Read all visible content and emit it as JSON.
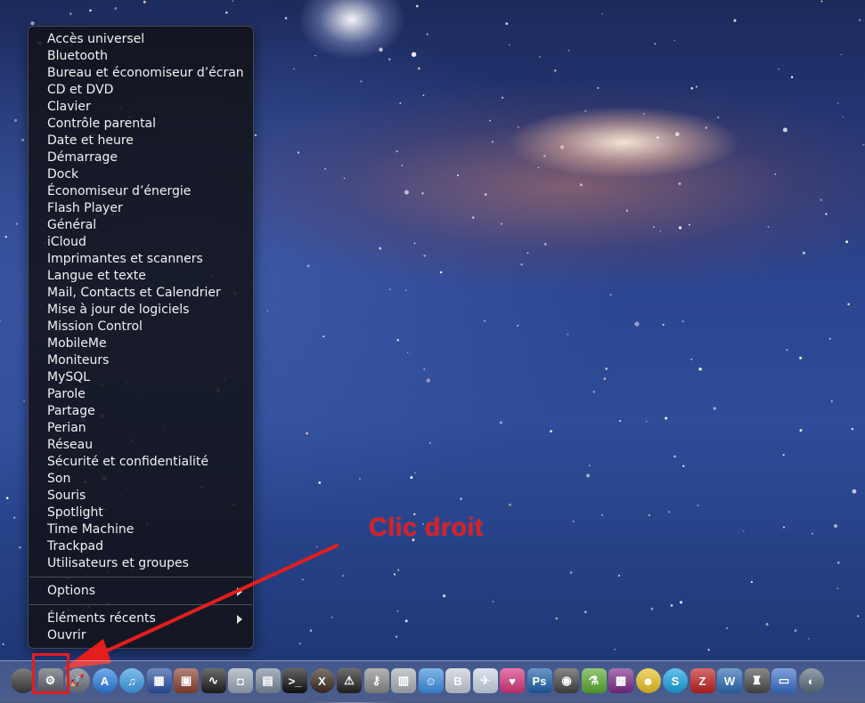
{
  "context_menu": {
    "items": [
      "Accès universel",
      "Bluetooth",
      "Bureau et économiseur d’écran",
      "CD et DVD",
      "Clavier",
      "Contrôle parental",
      "Date et heure",
      "Démarrage",
      "Dock",
      "Économiseur d’énergie",
      "Flash Player",
      "Général",
      "iCloud",
      "Imprimantes et scanners",
      "Langue et texte",
      "Mail, Contacts et Calendrier",
      "Mise à jour de logiciels",
      "Mission Control",
      "MobileMe",
      "Moniteurs",
      "MySQL",
      "Parole",
      "Partage",
      "Perian",
      "Réseau",
      "Sécurité et confidentialité",
      "Son",
      "Souris",
      "Spotlight",
      "Time Machine",
      "Trackpad",
      "Utilisateurs et groupes"
    ],
    "options_label": "Options",
    "recent_label": "Éléments récents",
    "open_label": "Ouvrir"
  },
  "annotation": {
    "text": "Clic droit",
    "color": "#e41d1d"
  },
  "dock": {
    "icons": [
      {
        "name": "dashboard-icon",
        "color": "#3a3a3a",
        "glyph": "",
        "round": true
      },
      {
        "name": "system-preferences-icon",
        "color": "#5a5f66",
        "glyph": "⚙",
        "round": false
      },
      {
        "name": "launchpad-icon",
        "color": "#6c7480",
        "glyph": "🚀",
        "round": true
      },
      {
        "name": "app-store-icon",
        "color": "#2a7de1",
        "glyph": "A",
        "round": true
      },
      {
        "name": "itunes-icon",
        "color": "#3b9be6",
        "glyph": "♫",
        "round": true
      },
      {
        "name": "imovie-icon",
        "color": "#2a4fa0",
        "glyph": "▦",
        "round": false
      },
      {
        "name": "photo-booth-icon",
        "color": "#8a4030",
        "glyph": "▣",
        "round": false
      },
      {
        "name": "activity-monitor-icon",
        "color": "#1e1e1e",
        "glyph": "∿",
        "round": false
      },
      {
        "name": "disk-utility-icon",
        "color": "#9aa6b4",
        "glyph": "◘",
        "round": false
      },
      {
        "name": "system-profiler-icon",
        "color": "#7a8a9c",
        "glyph": "▤",
        "round": false
      },
      {
        "name": "terminal-icon",
        "color": "#111111",
        "glyph": ">_",
        "round": false
      },
      {
        "name": "x11-icon",
        "color": "#3a2a20",
        "glyph": "X",
        "round": true
      },
      {
        "name": "console-icon",
        "color": "#222222",
        "glyph": "⚠",
        "round": false
      },
      {
        "name": "keychain-icon",
        "color": "#8a8a8a",
        "glyph": "⚷",
        "round": false
      },
      {
        "name": "system-information-icon",
        "color": "#a8b0b8",
        "glyph": "▥",
        "round": false
      },
      {
        "name": "messenger-icon",
        "color": "#3c8de0",
        "glyph": "☺",
        "round": false
      },
      {
        "name": "bbedit-icon",
        "color": "#c8ccd8",
        "glyph": "B",
        "round": false
      },
      {
        "name": "mail-icon",
        "color": "#c9d6e6",
        "glyph": "✈",
        "round": false
      },
      {
        "name": "heart-app-icon",
        "color": "#d6337a",
        "glyph": "♥",
        "round": false
      },
      {
        "name": "photoshop-icon",
        "color": "#1b5fa8",
        "glyph": "Ps",
        "round": false
      },
      {
        "name": "camera-icon",
        "color": "#444444",
        "glyph": "◉",
        "round": false
      },
      {
        "name": "potion-icon",
        "color": "#5aa830",
        "glyph": "⚗",
        "round": false
      },
      {
        "name": "photo-slideshow-icon",
        "color": "#7a2a8a",
        "glyph": "▩",
        "round": false
      },
      {
        "name": "adium-icon",
        "color": "#e8c020",
        "glyph": "☻",
        "round": true
      },
      {
        "name": "skype-icon",
        "color": "#18a0e0",
        "glyph": "S",
        "round": true
      },
      {
        "name": "filezilla-icon",
        "color": "#c01e1e",
        "glyph": "Z",
        "round": false
      },
      {
        "name": "word-icon",
        "color": "#2a6ab0",
        "glyph": "W",
        "round": false
      },
      {
        "name": "stickman-icon",
        "color": "#4a4a4a",
        "glyph": "♜",
        "round": false
      },
      {
        "name": "remote-desktop-icon",
        "color": "#3a6ec8",
        "glyph": "▭",
        "round": false
      },
      {
        "name": "migration-icon",
        "color": "#5a6a7a",
        "glyph": "◐",
        "round": true
      }
    ]
  }
}
